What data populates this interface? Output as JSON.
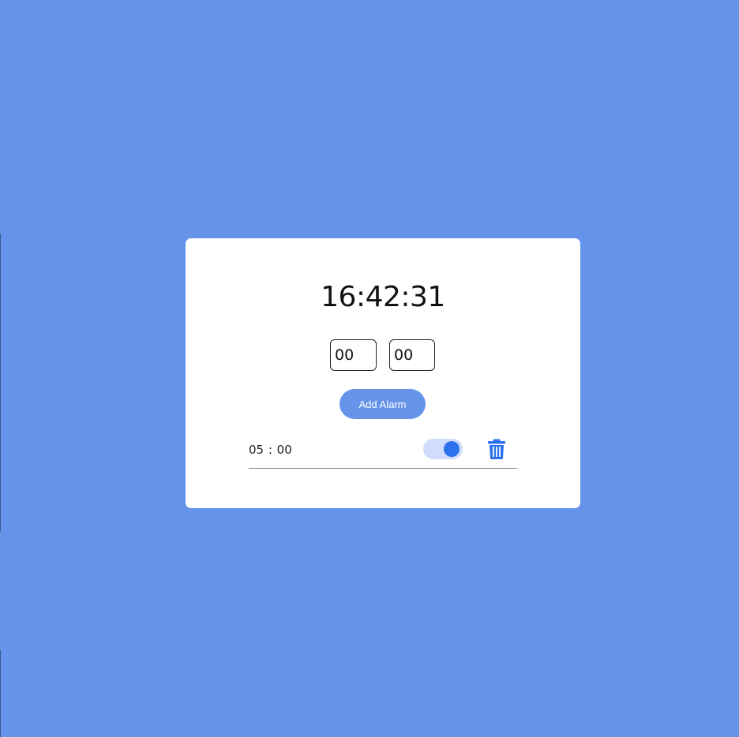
{
  "clock": {
    "current_time": "16:42:31"
  },
  "alarm_form": {
    "hour_value": "00",
    "minute_value": "00",
    "add_button_label": "Add Alarm"
  },
  "alarms": [
    {
      "time": "05 : 00",
      "enabled": true
    }
  ],
  "icons": {
    "delete": "trash-icon"
  },
  "colors": {
    "background": "#6594ea",
    "card": "#ffffff",
    "accent": "#2e72ee",
    "toggle_track": "#cfdcfb"
  }
}
